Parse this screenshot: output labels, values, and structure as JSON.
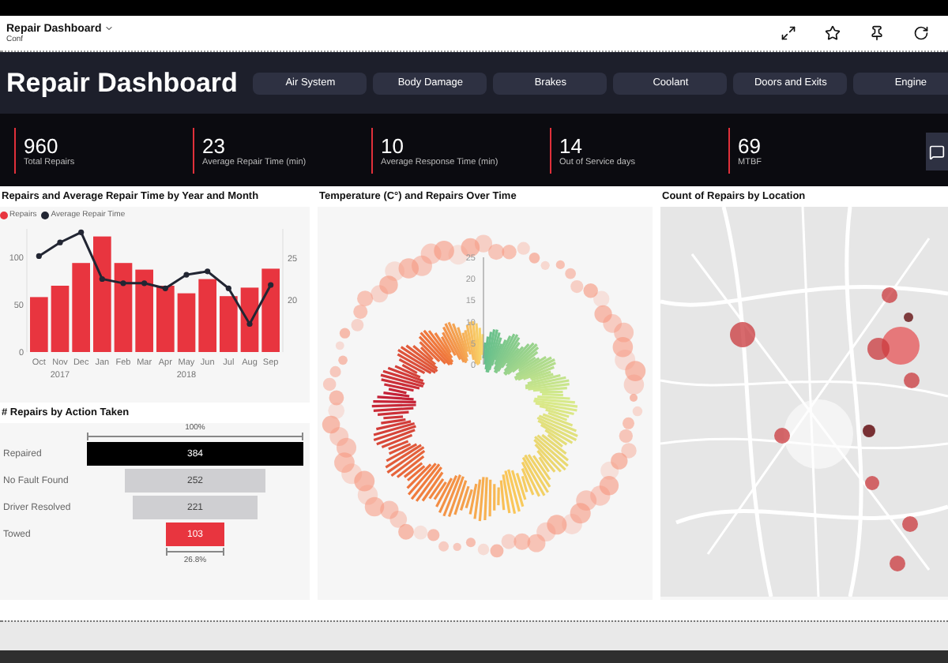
{
  "app_header": {
    "title": "Repair Dashboard",
    "workspace": "Conf"
  },
  "banner": {
    "title": "Repair Dashboard",
    "filters": [
      {
        "label": "Air System"
      },
      {
        "label": "Body Damage"
      },
      {
        "label": "Brakes"
      },
      {
        "label": "Coolant"
      },
      {
        "label": "Doors and Exits"
      },
      {
        "label": "Engine"
      }
    ]
  },
  "kpis": [
    {
      "value": "960",
      "label": "Total Repairs"
    },
    {
      "value": "23",
      "label": "Average Repair Time (min)"
    },
    {
      "value": "10",
      "label": "Average Response Time (min)"
    },
    {
      "value": "14",
      "label": "Out of Service days"
    },
    {
      "value": "69",
      "label": "MTBF"
    }
  ],
  "repairs_chart": {
    "title": "Repairs and Average Repair Time by Year and Month",
    "repairs": {
      "chart_data": {
        "type": "bar",
        "categories": [
          "Oct",
          "Nov",
          "Dec",
          "Jan",
          "Feb",
          "Mar",
          "Apr",
          "May",
          "Jun",
          "Jul",
          "Aug",
          "Sep"
        ],
        "series": [
          {
            "name": "Repairs",
            "color": "#e8353f",
            "values": [
              58,
              70,
              94,
              122,
              94,
              87,
              70,
              62,
              77,
              59,
              68,
              88
            ]
          }
        ],
        "ylim": [
          0,
          130
        ],
        "yticks": [
          0,
          50,
          100
        ]
      }
    },
    "repair_time": {
      "chart_data": {
        "type": "line",
        "series": [
          {
            "name": "Average Repair Time",
            "color": "#222633",
            "marker": "o",
            "values": [
              25.2,
              26.8,
              28,
              22.5,
              22,
              22,
              21.4,
              23,
              23.4,
              21.4,
              17.2,
              21.8
            ]
          }
        ],
        "ylim": [
          13.9,
          28.4
        ],
        "yticks": [
          20,
          25
        ]
      }
    },
    "year_labels": [
      "2017",
      "2018"
    ]
  },
  "action_chart": {
    "title": "# Repairs by Action Taken",
    "top_share": "100%",
    "bottom_share": "26.8%",
    "rows": [
      {
        "label": "Repaired",
        "value": "384",
        "color": "#000000"
      },
      {
        "label": "No Fault Found",
        "value": "252",
        "color": "#cfcfd2"
      },
      {
        "label": "Driver Resolved",
        "value": "221",
        "color": "#cfcfd2"
      },
      {
        "label": "Towed",
        "value": "103",
        "color": "#e8353f"
      }
    ]
  },
  "temperature_chart": {
    "title": "Temperature (C°) and Repairs Over Time",
    "axis_ticks": [
      "25",
      "20",
      "15",
      "10",
      "5",
      "0"
    ]
  },
  "location_map": {
    "title": "Count of Repairs by Location"
  }
}
